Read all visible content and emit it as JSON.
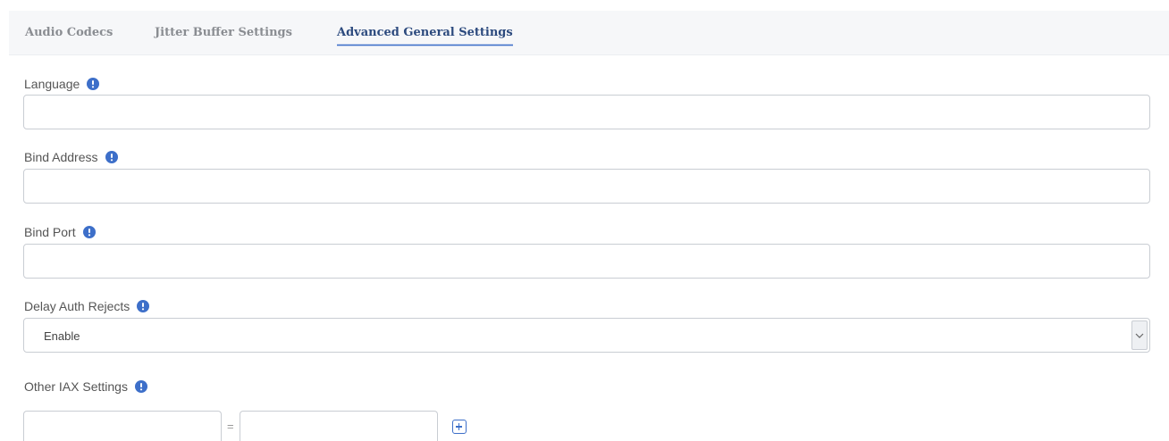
{
  "tabs": {
    "audio_codecs": "Audio Codecs",
    "jitter_buffer": "Jitter Buffer Settings",
    "advanced_general": "Advanced General Settings"
  },
  "fields": {
    "language": {
      "label": "Language",
      "value": ""
    },
    "bind_address": {
      "label": "Bind Address",
      "value": ""
    },
    "bind_port": {
      "label": "Bind Port",
      "value": ""
    },
    "delay_auth_rejects": {
      "label": "Delay Auth Rejects",
      "value": "Enable"
    },
    "other_iax_settings": {
      "label": "Other IAX Settings",
      "key": "",
      "value": "",
      "separator": "="
    }
  },
  "icons": {
    "info": "info-icon",
    "dropdown": "chevron-down-icon",
    "add": "plus-square-icon"
  },
  "colors": {
    "active_tab": "#2c4a7e",
    "inactive_tab": "#8a8d92",
    "accent": "#3d6fc9",
    "tabbar_bg": "#f6f7f9"
  }
}
